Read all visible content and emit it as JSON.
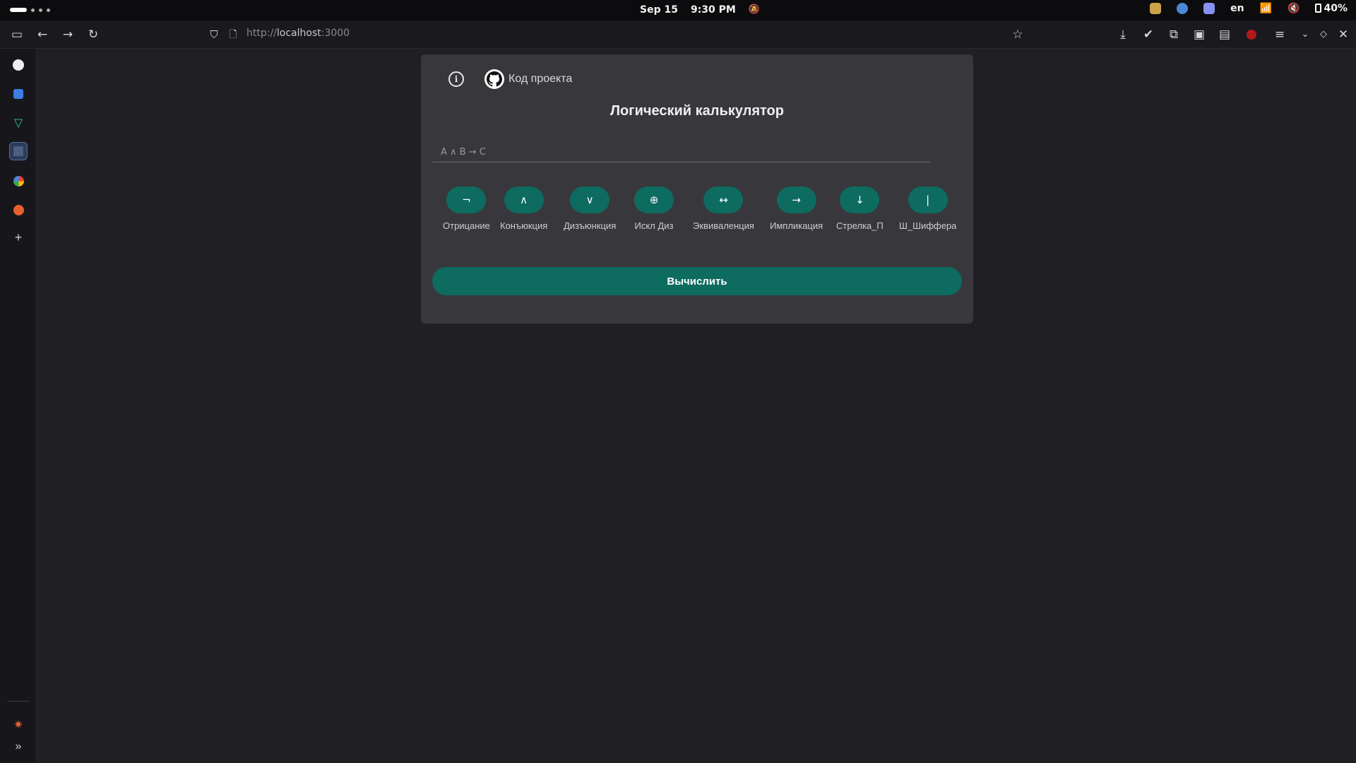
{
  "system": {
    "date": "Sep 15",
    "time": "9:30 PM",
    "language": "en",
    "battery": "40%"
  },
  "browser": {
    "url_protocol": "http://",
    "url_host": "localhost",
    "url_port": ":3000"
  },
  "sidebar": {
    "items": [
      {
        "name": "github",
        "icon": "github-icon"
      },
      {
        "name": "translate",
        "icon": "translate-icon"
      },
      {
        "name": "vue",
        "icon": "vue-icon"
      },
      {
        "name": "dashboard",
        "icon": "grid-icon"
      },
      {
        "name": "google",
        "icon": "google-icon"
      },
      {
        "name": "firefox",
        "icon": "firefox-icon"
      },
      {
        "name": "add",
        "icon": "plus-icon"
      }
    ]
  },
  "card": {
    "project_link": "Код проекта",
    "title": "Логический калькулятор",
    "input_placeholder": "A ∧ B → C",
    "calculate_label": "Вычислить"
  },
  "operators": [
    {
      "symbol": "¬",
      "label": "Отрицание"
    },
    {
      "symbol": "∧",
      "label": "Конъюкция"
    },
    {
      "symbol": "∨",
      "label": "Дизъюнкция"
    },
    {
      "symbol": "⊕",
      "label": "Искл Диз"
    },
    {
      "symbol": "↔",
      "label": "Эквиваленция"
    },
    {
      "symbol": "→",
      "label": "Импликация"
    },
    {
      "symbol": "↓",
      "label": "Стрелка_П"
    },
    {
      "symbol": "|",
      "label": "Ш_Шиффера"
    }
  ],
  "colors": {
    "accent": "#0d6b60",
    "card_bg": "#38383c",
    "page_bg": "#1f1f24"
  }
}
